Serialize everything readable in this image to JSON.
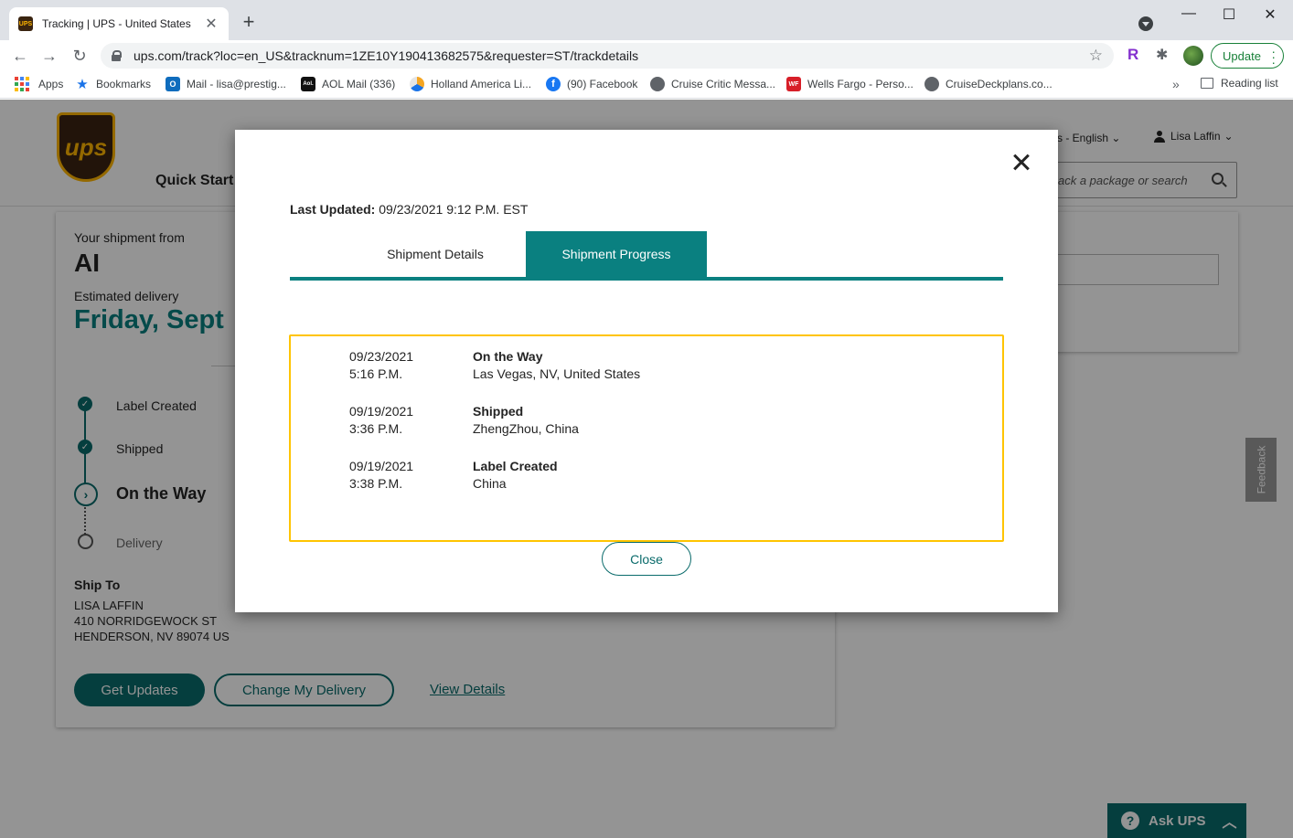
{
  "browser": {
    "tab_title": "Tracking | UPS - United States",
    "tab_favicon": "UPS",
    "url": "ups.com/track?loc=en_US&tracknum=1ZE10Y190413682575&requester=ST/trackdetails",
    "update_label": "Update",
    "bookmarks": [
      {
        "label": "Apps",
        "icon": "apps-grid-icon"
      },
      {
        "label": "Bookmarks",
        "icon": "star-icon"
      },
      {
        "label": "Mail - lisa@prestig...",
        "icon": "outlook-icon"
      },
      {
        "label": "AOL Mail (336)",
        "icon": "aol-icon"
      },
      {
        "label": "Holland America Li...",
        "icon": "holland-america-icon"
      },
      {
        "label": "(90) Facebook",
        "icon": "facebook-icon"
      },
      {
        "label": "Cruise Critic Messa...",
        "icon": "globe-icon"
      },
      {
        "label": "Wells Fargo - Perso...",
        "icon": "wells-fargo-icon"
      },
      {
        "label": "CruiseDeckplans.co...",
        "icon": "globe-icon"
      }
    ],
    "reading_list": "Reading list",
    "ext_r": "R"
  },
  "ups": {
    "logo_text": "ups",
    "quick_start": "Quick Start",
    "language": "s - English",
    "user_name": "Lisa Laffin",
    "search_placeholder": "ack a package or search"
  },
  "shipment": {
    "from_label": "Your shipment from",
    "shipper": "AI",
    "est_label": "Estimated delivery",
    "est_date": "Friday, Sept",
    "steps": [
      "Label Created",
      "Shipped",
      "On the Way",
      "Delivery"
    ],
    "ship_to_label": "Ship To",
    "address": [
      "LISA LAFFIN",
      "410 NORRIDGEWOCK ST",
      "HENDERSON, NV 89074 US"
    ],
    "get_updates": "Get Updates",
    "change_delivery": "Change My Delivery",
    "view_details": "View Details",
    "feedback": "Feedback",
    "ask_ups": "Ask UPS"
  },
  "modal": {
    "last_updated_label": "Last Updated:",
    "last_updated_value": "09/23/2021 9:12 P.M. EST",
    "tabs": [
      {
        "label": "Shipment Details",
        "active": false
      },
      {
        "label": "Shipment Progress",
        "active": true
      }
    ],
    "events": [
      {
        "date": "09/23/2021",
        "time": "5:16 P.M.",
        "status": "On the Way",
        "location": "Las Vegas, NV, United States"
      },
      {
        "date": "09/19/2021",
        "time": "3:36 P.M.",
        "status": "Shipped",
        "location": "ZhengZhou, China"
      },
      {
        "date": "09/19/2021",
        "time": "3:38 P.M.",
        "status": "Label Created",
        "location": "China"
      }
    ],
    "close_label": "Close"
  },
  "colors": {
    "ups_teal": "#0a8080",
    "ups_dark_teal": "#0a6b6b",
    "highlight_border": "#ffc400",
    "ups_brown": "#3b2412",
    "ups_gold": "#ffb500"
  }
}
